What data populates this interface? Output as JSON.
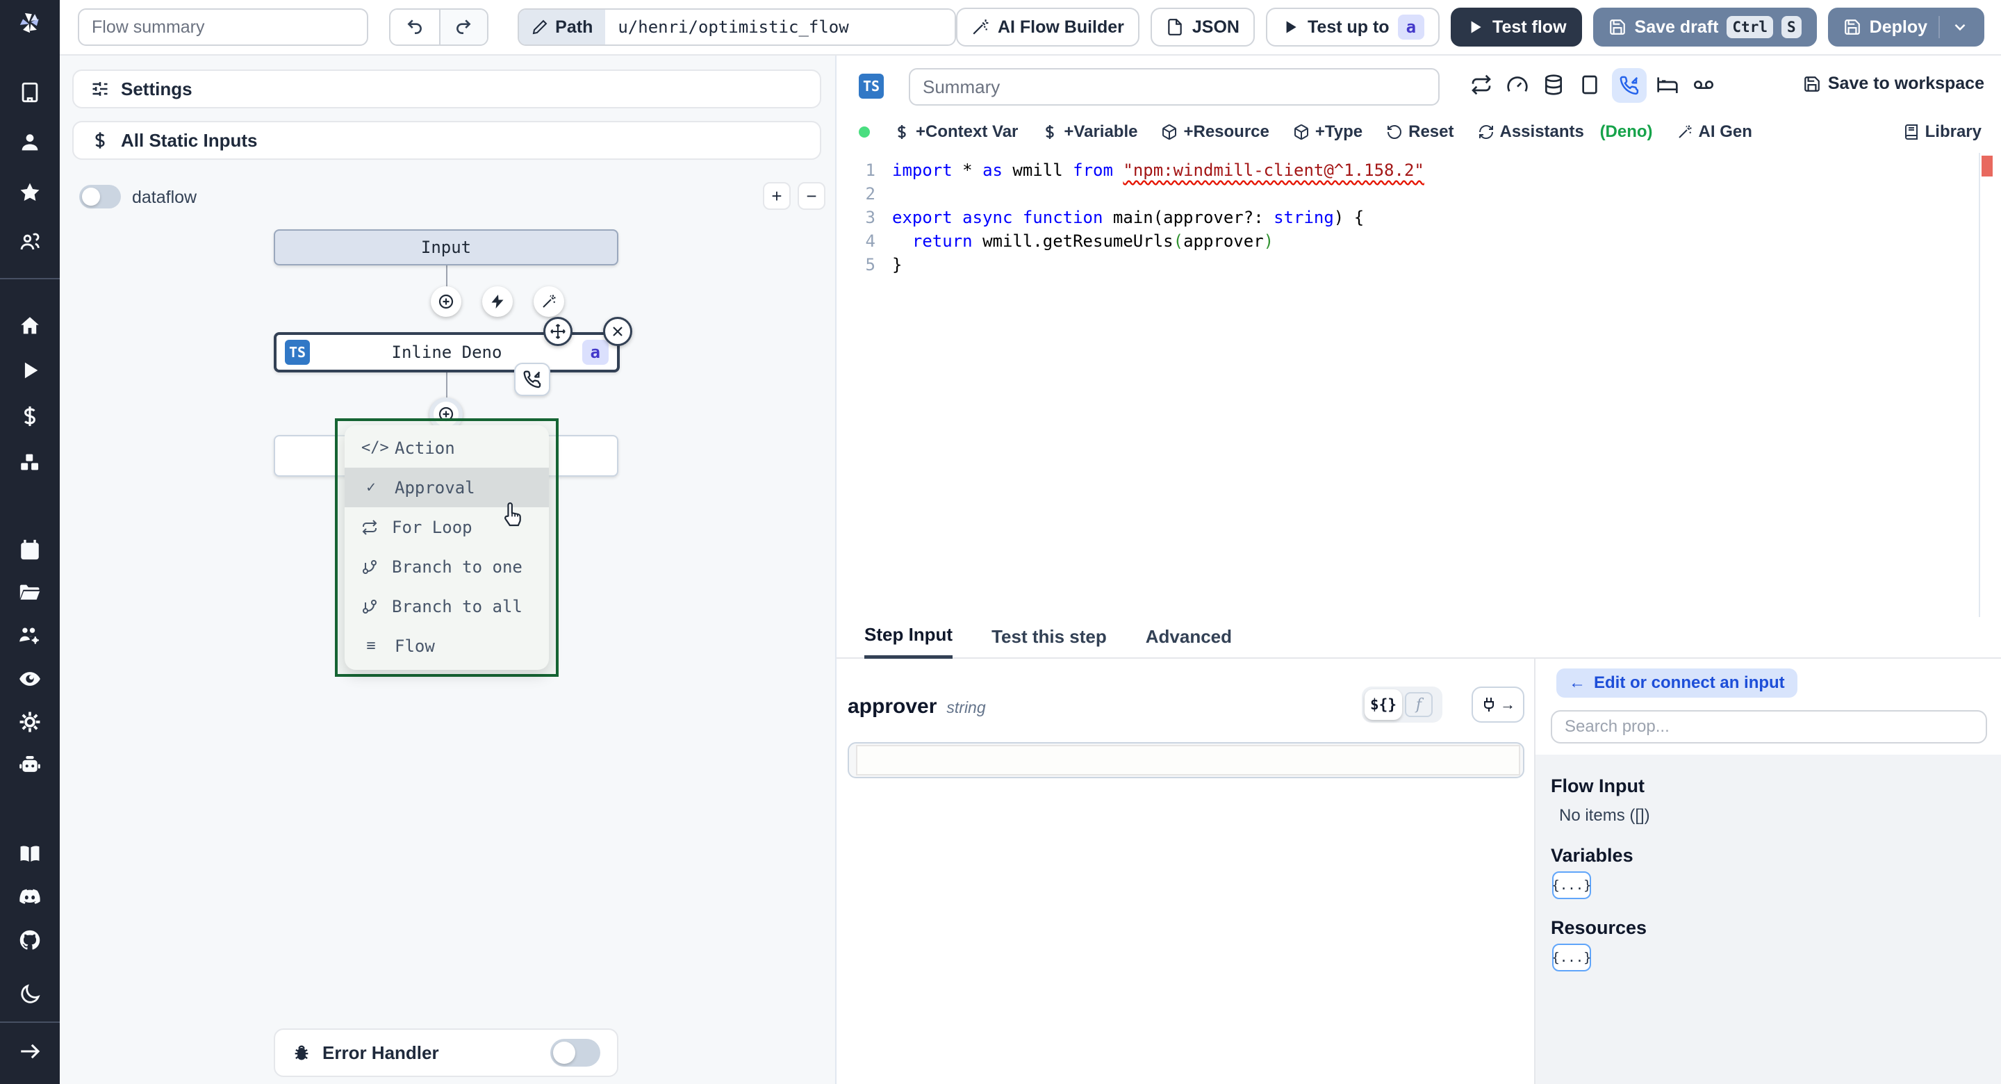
{
  "header": {
    "flow_summary_placeholder": "Flow summary",
    "path_label": "Path",
    "path_value": "u/henri/optimistic_flow",
    "ai_flow_builder": "AI Flow Builder",
    "json_label": "JSON",
    "test_up_to": "Test up to",
    "test_up_to_badge": "a",
    "test_flow": "Test flow",
    "save_draft": "Save draft",
    "kbd_ctrl": "Ctrl",
    "kbd_s": "S",
    "deploy": "Deploy"
  },
  "canvas": {
    "settings": "Settings",
    "all_static_inputs": "All Static Inputs",
    "dataflow": "dataflow",
    "zoom_in": "+",
    "zoom_out": "−",
    "input_node": "Input",
    "step_node": {
      "lang_badge": "TS",
      "label": "Inline Deno",
      "suffix_badge": "a"
    },
    "menu": {
      "items": [
        {
          "label": "Action"
        },
        {
          "label": "Approval"
        },
        {
          "label": "For Loop"
        },
        {
          "label": "Branch to one"
        },
        {
          "label": "Branch to all"
        },
        {
          "label": "Flow"
        }
      ]
    },
    "error_handler": "Error Handler"
  },
  "editor": {
    "lang_badge": "TS",
    "summary_placeholder": "Summary",
    "toolbar": {
      "context_var": "+Context Var",
      "variable": "+Variable",
      "resource": "+Resource",
      "type": "+Type",
      "reset": "Reset",
      "assistants": "Assistants",
      "assistants_lang": "(Deno)",
      "ai_gen": "AI Gen",
      "library": "Library",
      "save_to_workspace": "Save to workspace"
    },
    "lines": [
      [
        {
          "t": "import ",
          "c": "kw"
        },
        {
          "t": "* ",
          "c": ""
        },
        {
          "t": "as ",
          "c": "kw"
        },
        {
          "t": "wmill ",
          "c": ""
        },
        {
          "t": "from ",
          "c": "kw"
        },
        {
          "t": "\"npm:windmill-client@^1.158.2\"",
          "c": "str sq"
        }
      ],
      [],
      [
        {
          "t": "export ",
          "c": "kw"
        },
        {
          "t": "async ",
          "c": "kw"
        },
        {
          "t": "function ",
          "c": "kw"
        },
        {
          "t": "main(approver?: ",
          "c": ""
        },
        {
          "t": "string",
          "c": "kw"
        },
        {
          "t": ") {",
          "c": ""
        }
      ],
      [
        {
          "t": "  ",
          "c": ""
        },
        {
          "t": "return ",
          "c": "kw"
        },
        {
          "t": "wmill.getResumeUrls",
          "c": ""
        },
        {
          "t": "(",
          "c": "par"
        },
        {
          "t": "approver",
          "c": ""
        },
        {
          "t": ")",
          "c": "par"
        }
      ],
      [
        {
          "t": "}",
          "c": ""
        }
      ]
    ]
  },
  "step_panel": {
    "tab_step_input": "Step Input",
    "tab_test_step": "Test this step",
    "tab_advanced": "Advanced",
    "field_name": "approver",
    "field_type": "string",
    "toggle_expr": "${}",
    "toggle_fn": "f",
    "plug_arrow": "→"
  },
  "connect_panel": {
    "back_arrow": "←",
    "back_label": "Edit or connect an input",
    "search_placeholder": "Search prop...",
    "flow_input_title": "Flow Input",
    "flow_input_empty": "No items ([])",
    "variables_title": "Variables",
    "variables_chip": "{...}",
    "resources_title": "Resources",
    "resources_chip": "{...}"
  }
}
